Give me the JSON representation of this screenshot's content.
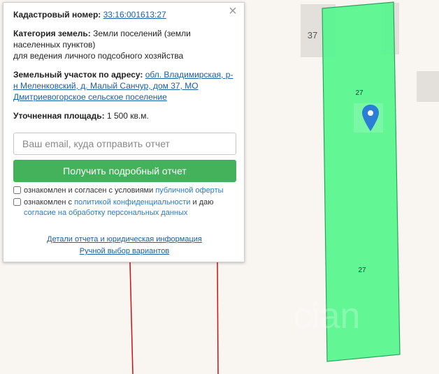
{
  "map": {
    "lot_label_37": "37",
    "parcel_label_top": "27",
    "parcel_label_bottom": "27",
    "watermark": "cian",
    "colors": {
      "parcel_fill": "#55f58d",
      "parcel_stroke": "#2ca35c",
      "boundary": "#cc1111",
      "marker": "#2b7ed6",
      "background": "#f9f6f2",
      "building": "#e3e0dc"
    }
  },
  "popup": {
    "cadastral_label": "Кадастровый номер:",
    "cadastral_number": "33:16:001613:27",
    "category_label": "Категория земель:",
    "category_value_1": "Земли поселений (земли",
    "category_value_2": "населенных пунктов)",
    "category_value_3": "для ведения личного подсобного хозяйства",
    "address_label": "Земельный участок по адресу:",
    "address_1": "обл. Владимирская, р-",
    "address_2": "н Меленковский, д. Малый Санчур, дом 37, МО",
    "address_3": "Дмитриевогорское сельское поселение",
    "area_label": "Уточненная площадь:",
    "area_value": "1 500 кв.м.",
    "email_placeholder": "Ваш email, куда отправить отчет",
    "button_label": "Получить подробный отчет",
    "consent1_text": "ознакомлен и согласен с условиями",
    "consent1_link": "публичной оферты",
    "consent2_text_a": "ознакомлен с",
    "consent2_link": "политикой конфиденциальности",
    "consent2_text_b": "и даю",
    "consent2_link2": "согласие на обработку персональных данных",
    "details_link": "Детали отчета и юридическая информация",
    "manual_link": "Ручной выбор вариантов",
    "close_icon": "close-icon"
  }
}
